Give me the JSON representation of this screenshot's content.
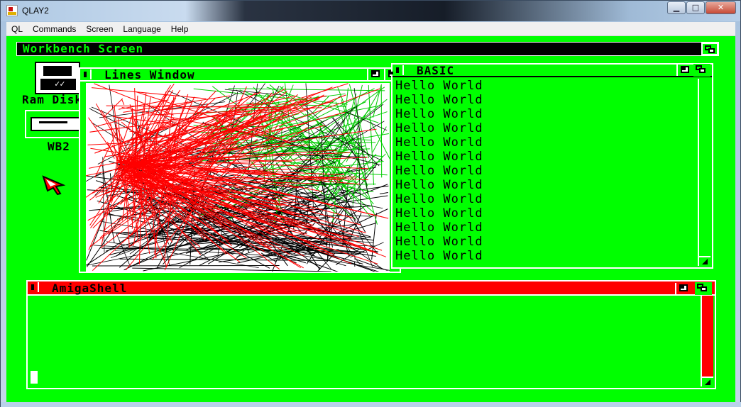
{
  "app": {
    "title": "QLAY2",
    "caption_buttons": {
      "minimize": "▁",
      "maximize": "□",
      "close": "✕"
    }
  },
  "menu": [
    "QL",
    "Commands",
    "Screen",
    "Language",
    "Help"
  ],
  "amiga": {
    "screen_title": "Workbench Screen",
    "icons": [
      {
        "label": "Ram Disk",
        "icon": "floppy-disk-icon"
      },
      {
        "label": "WB2",
        "icon": "drawer-icon"
      }
    ],
    "windows": {
      "lines": {
        "title": "Lines Window"
      },
      "basic": {
        "title": "BASIC",
        "lines": [
          "Hello World",
          "Hello World",
          "Hello World",
          "Hello World",
          "Hello World",
          "Hello World",
          "Hello World",
          "Hello World",
          "Hello World",
          "Hello World",
          "Hello World",
          "Hello World",
          "Hello World"
        ]
      },
      "shell": {
        "title": "AmigaShell"
      }
    },
    "colors": {
      "background": "#00ff00",
      "frame": "#ffffff",
      "text": "#000000",
      "accent": "#ff0000"
    }
  }
}
